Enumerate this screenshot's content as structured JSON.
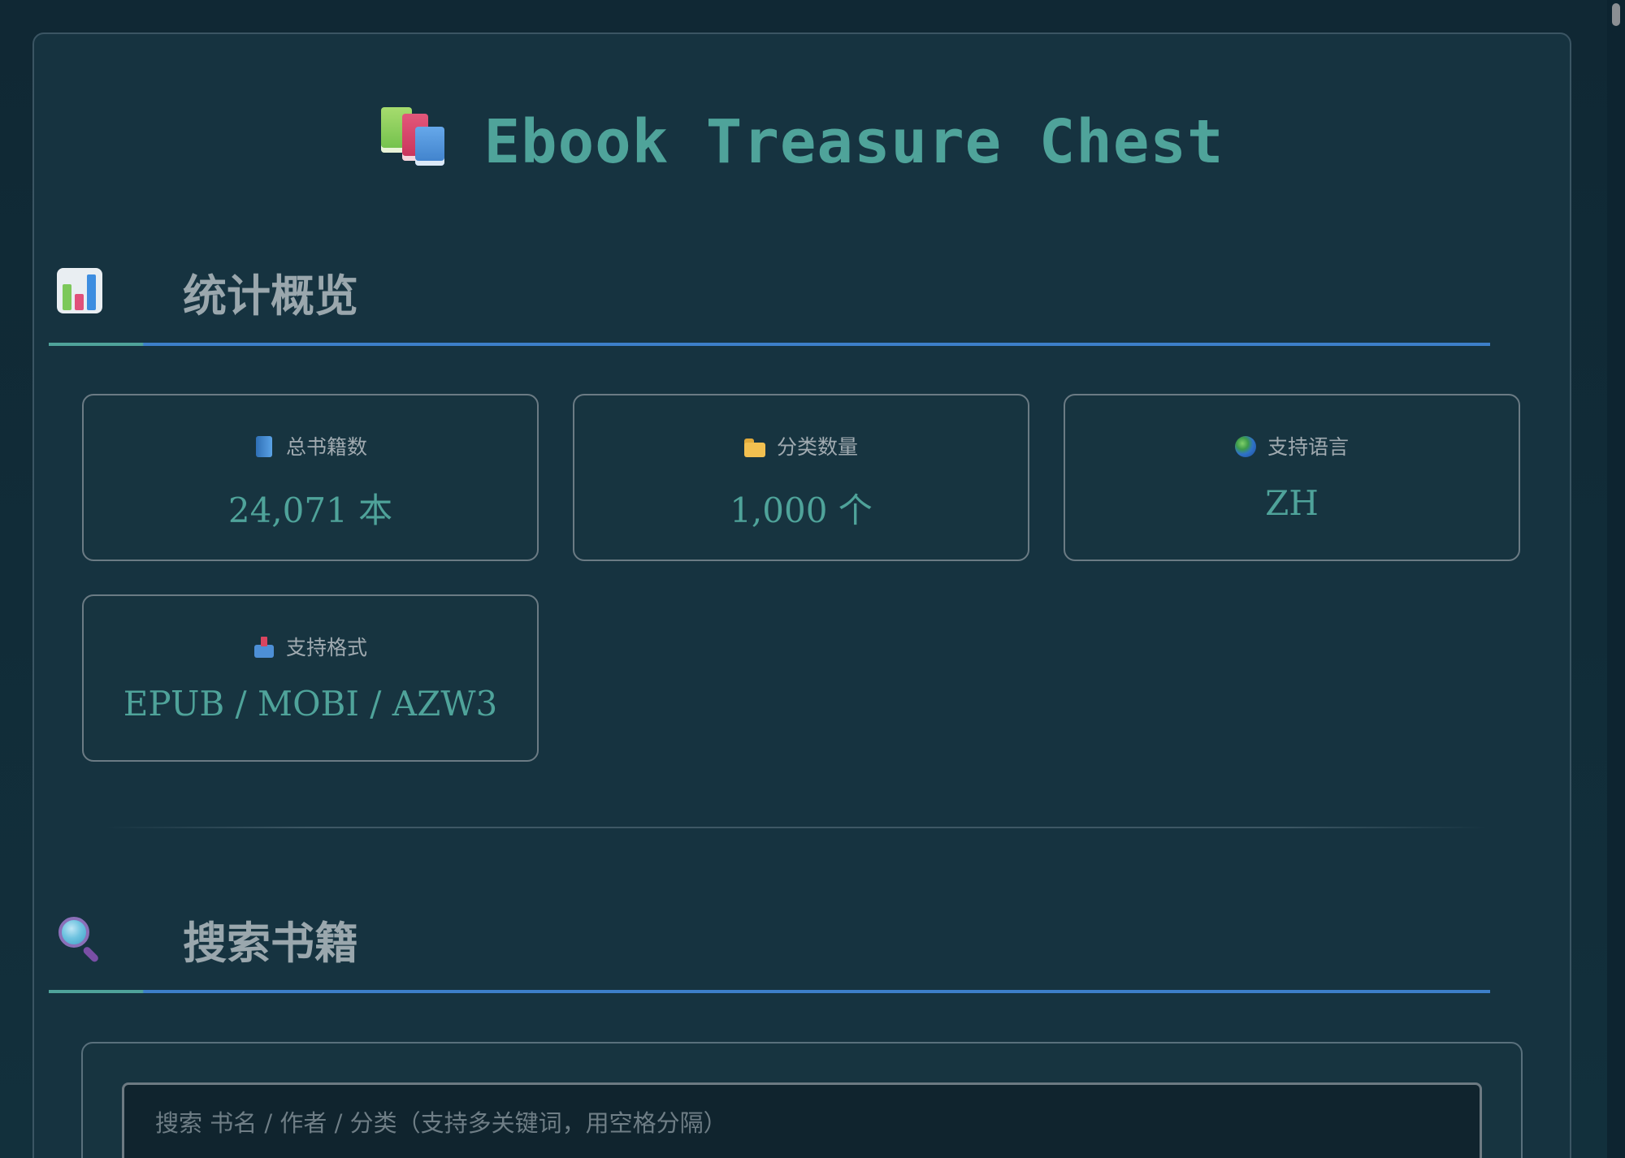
{
  "app": {
    "title": "Ebook Treasure Chest",
    "title_icon": "books-icon"
  },
  "sections": {
    "stats": {
      "title": "统计概览",
      "icon": "bar-chart-icon"
    },
    "search": {
      "title": "搜索书籍",
      "icon": "magnifier-icon",
      "input_placeholder": "搜索 书名 / 作者 / 分类（支持多关键词，用空格分隔）",
      "input_value": ""
    }
  },
  "stats": [
    {
      "icon": "blue-book-icon",
      "label": "总书籍数",
      "value": "24,071 本"
    },
    {
      "icon": "folder-icon",
      "label": "分类数量",
      "value": "1,000 个"
    },
    {
      "icon": "globe-icon",
      "label": "支持语言",
      "value": "ZH"
    },
    {
      "icon": "inbox-tray-icon",
      "label": "支持格式",
      "value": "EPUB / MOBI / AZW3"
    }
  ],
  "colors": {
    "accent": "#4fa39a",
    "underline_blue": "#3d7fc9",
    "panel": "#163340",
    "background": "#102834"
  }
}
